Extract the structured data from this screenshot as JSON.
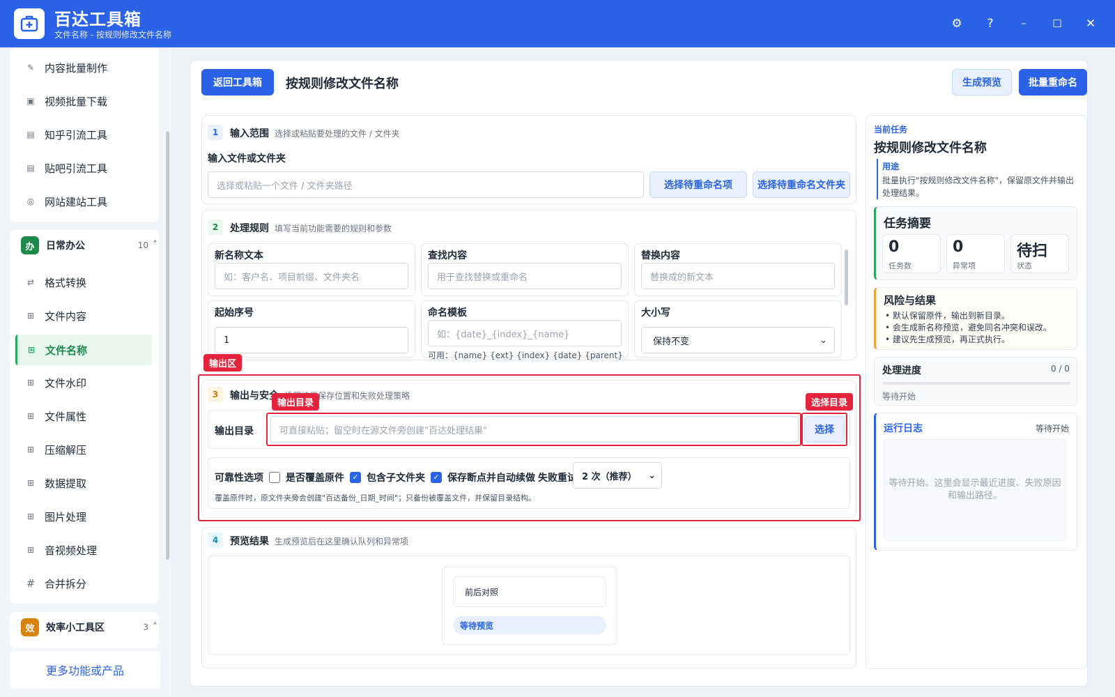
{
  "titlebar": {
    "app_name": "百达工具箱",
    "subtitle": "文件名称 - 按规则修改文件名称"
  },
  "sidebar": {
    "top_items": [
      {
        "label": "内容批量制作",
        "icon": "pencil-icon",
        "glyph": "✎"
      },
      {
        "label": "视频批量下载",
        "icon": "video-icon",
        "glyph": "▣"
      },
      {
        "label": "知乎引流工具",
        "icon": "zhihu-icon",
        "glyph": "▤"
      },
      {
        "label": "贴吧引流工具",
        "icon": "tieba-icon",
        "glyph": "▤"
      },
      {
        "label": "网站建站工具",
        "icon": "globe-icon",
        "glyph": "◎"
      }
    ],
    "group_office": {
      "badge": "办",
      "title": "日常办公",
      "count": "10",
      "chevron": "˄"
    },
    "office_items": [
      {
        "label": "格式转换",
        "icon": "swap-icon",
        "glyph": "⇄"
      },
      {
        "label": "文件内容",
        "icon": "grid-icon",
        "glyph": "⊞"
      },
      {
        "label": "文件名称",
        "icon": "grid-icon",
        "glyph": "⊞"
      },
      {
        "label": "文件水印",
        "icon": "grid-icon",
        "glyph": "⊞"
      },
      {
        "label": "文件属性",
        "icon": "grid-icon",
        "glyph": "⊞"
      },
      {
        "label": "压缩解压",
        "icon": "grid-icon",
        "glyph": "⊞"
      },
      {
        "label": "数据提取",
        "icon": "grid-icon",
        "glyph": "⊞"
      },
      {
        "label": "图片处理",
        "icon": "grid-icon",
        "glyph": "⊞"
      },
      {
        "label": "音视频处理",
        "icon": "grid-icon",
        "glyph": "⊞"
      },
      {
        "label": "合并拆分",
        "icon": "hash-icon",
        "glyph": "#"
      }
    ],
    "group_efficiency": {
      "badge": "效",
      "title": "效率小工具区",
      "count": "3",
      "chevron": "˄"
    },
    "more": "更多功能或产品"
  },
  "header": {
    "back": "返回工具箱",
    "title": "按规则修改文件名称",
    "preview": "生成预览",
    "rename": "批量重命名"
  },
  "step1": {
    "num": "1",
    "title": "输入范围",
    "hint": "选择或粘贴要处理的文件 / 文件夹",
    "label": "输入文件或文件夹",
    "placeholder": "选择或粘贴一个文件 / 文件夹路径",
    "btn_items": "选择待重命名项",
    "btn_folder": "选择待重命名文件夹"
  },
  "step2": {
    "num": "2",
    "title": "处理规则",
    "hint": "填写当前功能需要的规则和参数",
    "new_name_label": "新名称文本",
    "new_name_ph": "如：客户名、项目前缀、文件夹名",
    "find_label": "查找内容",
    "find_ph": "用于查找替换或重命名",
    "replace_label": "替换内容",
    "replace_ph": "替换成的新文本",
    "start_label": "起始序号",
    "start_val": "1",
    "template_label": "命名模板",
    "template_ph": "如：{date}_{index}_{name}",
    "template_hint": "可用：{name} {ext} {index} {date} {parent}",
    "case_label": "大小写",
    "case_val": "保持不变"
  },
  "step3": {
    "num": "3",
    "title": "输出与安全",
    "hint": "设置结果保存位置和失败处理策略",
    "outdir_label": "输出目录",
    "outdir_ph": "可直接粘贴；留空时在源文件旁创建\"百达处理结果\"",
    "select_btn": "选择",
    "rel_label": "可靠性选项",
    "overwrite": "是否覆盖原件",
    "subfolders": "包含子文件夹",
    "resume": "保存断点并自动续做",
    "retry_label": "失败重试",
    "retry_val": "2 次（推荐）",
    "note": "覆盖原件时，原文件夹旁会创建\"百达备份_日期_时间\"；只备份被覆盖文件，并保留目录结构。"
  },
  "annotations": {
    "output_area": "输出区",
    "output_dir": "输出目录",
    "select_dir": "选择目录"
  },
  "step4": {
    "num": "4",
    "title": "预览结果",
    "hint": "生成预览后在这里确认队列和异常项",
    "compare": "前后对照",
    "waiting": "等待预览"
  },
  "right": {
    "current_label": "当前任务",
    "current_title": "按规则修改文件名称",
    "usage_label": "用途",
    "usage_text": "批量执行\"按规则修改文件名称\"，保留原文件并输出处理结果。",
    "summary_title": "任务摘要",
    "stats": [
      {
        "value": "0",
        "label": "任务数"
      },
      {
        "value": "0",
        "label": "异常项"
      },
      {
        "value": "待扫",
        "label": "状态"
      }
    ],
    "risk_title": "风险与结果",
    "risks": [
      "默认保留原件，输出到新目录。",
      "会生成新名称预览，避免同名冲突和误改。",
      "建议先生成预览，再正式执行。"
    ],
    "progress_title": "处理进度",
    "progress_count": "0 / 0",
    "progress_status": "等待开始",
    "progress_fraction": 0,
    "log_title": "运行日志",
    "log_status": "等待开始",
    "log_text": "等待开始。这里会显示最近进度、失败原因和输出路径。"
  },
  "colors": {
    "primary": "#2a62e8",
    "green": "#2aa75f",
    "orange": "#e8a33a",
    "red": "#e4243c"
  }
}
